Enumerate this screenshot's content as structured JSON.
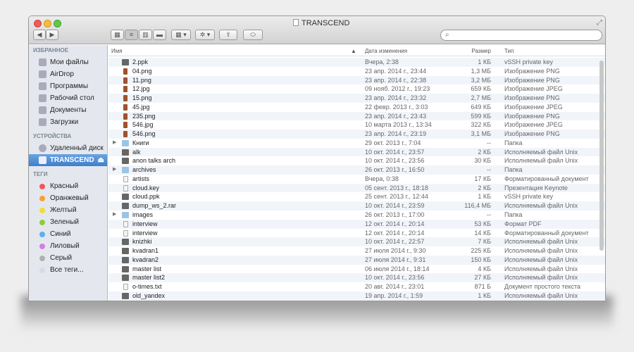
{
  "window": {
    "title": "TRANSCEND",
    "search_placeholder": ""
  },
  "toolbar": {
    "back": "◀",
    "forward": "▶",
    "view_icons": "▦",
    "view_list": "≡",
    "view_columns": "▥",
    "view_coverflow": "▬",
    "arrange": "▦ ▾",
    "action": "✲ ▾",
    "share": "⇪",
    "tags": "⬭"
  },
  "sidebar": {
    "favorites_header": "ИЗБРАННОЕ",
    "favorites": [
      {
        "label": "Мои файлы",
        "icon": "all-files-icon"
      },
      {
        "label": "AirDrop",
        "icon": "airdrop-icon"
      },
      {
        "label": "Программы",
        "icon": "applications-icon"
      },
      {
        "label": "Рабочий стол",
        "icon": "desktop-icon"
      },
      {
        "label": "Документы",
        "icon": "documents-icon"
      },
      {
        "label": "Загрузки",
        "icon": "downloads-icon"
      }
    ],
    "devices_header": "УСТРОЙСТВА",
    "devices": [
      {
        "label": "Удаленный диск",
        "icon": "remote-disc-icon"
      },
      {
        "label": "TRANSCEND",
        "icon": "drive-icon",
        "selected": true,
        "eject": "⏏"
      }
    ],
    "tags_header": "ТЕГИ",
    "tags": [
      {
        "label": "Красный",
        "color": "#f0595a"
      },
      {
        "label": "Оранжевый",
        "color": "#f8a030"
      },
      {
        "label": "Желтый",
        "color": "#f2dc38"
      },
      {
        "label": "Зеленый",
        "color": "#8fcc3c"
      },
      {
        "label": "Синий",
        "color": "#5cb0f0"
      },
      {
        "label": "Лиловый",
        "color": "#d07ee0"
      },
      {
        "label": "Серый",
        "color": "#b0b0b0"
      },
      {
        "label": "Все теги...",
        "color": "#d8dce2"
      }
    ]
  },
  "columns": {
    "name": "Имя",
    "sort": "▲",
    "date": "Дата изменения",
    "size": "Размер",
    "type": "Тип"
  },
  "files": [
    {
      "name": "2.ppk",
      "date": "Вчера, 2:38",
      "size": "1 КБ",
      "type": "vSSH private key",
      "kind": "file"
    },
    {
      "name": "04.png",
      "date": "23 апр. 2014 г., 23:44",
      "size": "1,3 МБ",
      "type": "Изображение PNG",
      "kind": "img"
    },
    {
      "name": "11.png",
      "date": "23 апр. 2014 г., 22:38",
      "size": "3,2 МБ",
      "type": "Изображение PNG",
      "kind": "img"
    },
    {
      "name": "12.jpg",
      "date": "09 нояб. 2012 г., 19:23",
      "size": "659 КБ",
      "type": "Изображение JPEG",
      "kind": "img"
    },
    {
      "name": "15.png",
      "date": "23 апр. 2014 г., 23:32",
      "size": "2,7 МБ",
      "type": "Изображение PNG",
      "kind": "img"
    },
    {
      "name": "45.jpg",
      "date": "22 февр. 2013 г., 3:03",
      "size": "649 КБ",
      "type": "Изображение JPEG",
      "kind": "img"
    },
    {
      "name": "235.png",
      "date": "23 апр. 2014 г., 23:43",
      "size": "599 КБ",
      "type": "Изображение PNG",
      "kind": "img"
    },
    {
      "name": "546.jpg",
      "date": "10 марта 2013 г., 13:34",
      "size": "322 КБ",
      "type": "Изображение JPEG",
      "kind": "img"
    },
    {
      "name": "546.png",
      "date": "23 апр. 2014 г., 23:19",
      "size": "3,1 МБ",
      "type": "Изображение PNG",
      "kind": "img"
    },
    {
      "name": "Книги",
      "date": "29 окт. 2013 г., 7:04",
      "size": "--",
      "type": "Папка",
      "kind": "folder"
    },
    {
      "name": "alk",
      "date": "10 окт. 2014 г., 23:57",
      "size": "2 КБ",
      "type": "Исполняемый файл Unix",
      "kind": "file"
    },
    {
      "name": "anon talks arch",
      "date": "10 окт. 2014 г., 23:56",
      "size": "30 КБ",
      "type": "Исполняемый файл Unix",
      "kind": "file"
    },
    {
      "name": "archives",
      "date": "26 окт. 2013 г., 16:50",
      "size": "--",
      "type": "Папка",
      "kind": "folder"
    },
    {
      "name": "artists",
      "date": "Вчера, 0:38",
      "size": "17 КБ",
      "type": "Форматированный документ",
      "kind": "doc"
    },
    {
      "name": "cloud.key",
      "date": "05 сент. 2013 г., 18:18",
      "size": "2 КБ",
      "type": "Презентация Keynote",
      "kind": "doc"
    },
    {
      "name": "cloud.ppk",
      "date": "25 сент. 2013 г., 12:44",
      "size": "1 КБ",
      "type": "vSSH private key",
      "kind": "file"
    },
    {
      "name": "dump_ws_2.rar",
      "date": "10 окт. 2014 г., 23:59",
      "size": "116,4 МБ",
      "type": "Исполняемый файл Unix",
      "kind": "file"
    },
    {
      "name": "images",
      "date": "26 окт. 2013 г., 17:00",
      "size": "--",
      "type": "Папка",
      "kind": "folder"
    },
    {
      "name": "interview",
      "date": "12 окт. 2014 г., 20:14",
      "size": "53 КБ",
      "type": "Формат PDF",
      "kind": "doc"
    },
    {
      "name": "interview",
      "date": "12 окт. 2014 г., 20:14",
      "size": "14 КБ",
      "type": "Форматированный документ",
      "kind": "doc"
    },
    {
      "name": "knizhki",
      "date": "10 окт. 2014 г., 22:57",
      "size": "7 КБ",
      "type": "Исполняемый файл Unix",
      "kind": "file"
    },
    {
      "name": "kvadran1",
      "date": "27 июля 2014 г., 9:30",
      "size": "225 КБ",
      "type": "Исполняемый файл Unix",
      "kind": "file"
    },
    {
      "name": "kvadran2",
      "date": "27 июля 2014 г., 9:31",
      "size": "150 КБ",
      "type": "Исполняемый файл Unix",
      "kind": "file"
    },
    {
      "name": "master list",
      "date": "06 июля 2014 г., 18:14",
      "size": "4 КБ",
      "type": "Исполняемый файл Unix",
      "kind": "file"
    },
    {
      "name": "master list2",
      "date": "10 окт. 2014 г., 23:56",
      "size": "27 КБ",
      "type": "Исполняемый файл Unix",
      "kind": "file"
    },
    {
      "name": "o-times.txt",
      "date": "20 авг. 2014 г., 23:01",
      "size": "871 Б",
      "type": "Документ простого текста",
      "kind": "doc"
    },
    {
      "name": "old_yandex",
      "date": "19 апр. 2014 г., 1:59",
      "size": "1 КБ",
      "type": "Исполняемый файл Unix",
      "kind": "file"
    }
  ]
}
